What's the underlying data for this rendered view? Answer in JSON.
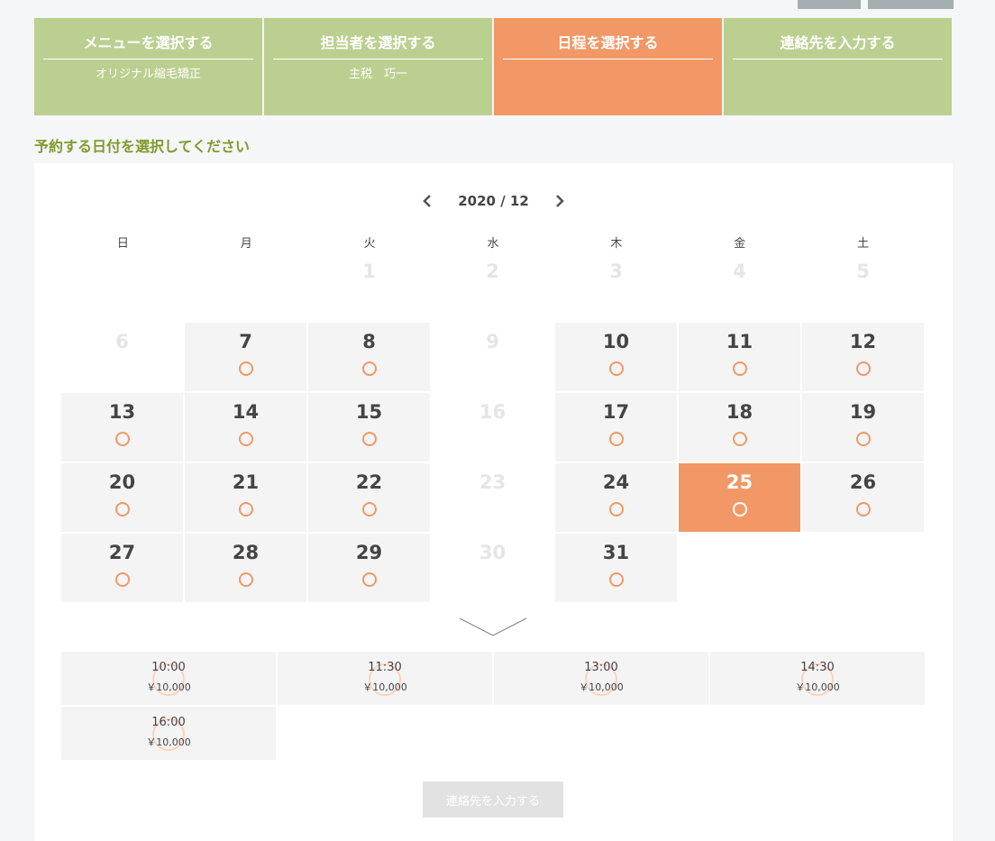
{
  "steps": [
    {
      "title": "メニューを選択する",
      "sub": "オリジナル縮毛矯正"
    },
    {
      "title": "担当者を選択する",
      "sub": "主税　巧一"
    },
    {
      "title": "日程を選択する",
      "sub": ""
    },
    {
      "title": "連絡先を入力する",
      "sub": ""
    }
  ],
  "heading": "予約する日付を選択してください",
  "calendar": {
    "month_label": "2020 / 12",
    "weekdays": [
      "日",
      "月",
      "火",
      "水",
      "木",
      "金",
      "土"
    ],
    "days": [
      {
        "n": "",
        "s": "blank"
      },
      {
        "n": "",
        "s": "blank"
      },
      {
        "n": "1",
        "s": "off"
      },
      {
        "n": "2",
        "s": "off"
      },
      {
        "n": "3",
        "s": "off"
      },
      {
        "n": "4",
        "s": "off"
      },
      {
        "n": "5",
        "s": "off"
      },
      {
        "n": "6",
        "s": "off"
      },
      {
        "n": "7",
        "s": "avail"
      },
      {
        "n": "8",
        "s": "avail"
      },
      {
        "n": "9",
        "s": "off"
      },
      {
        "n": "10",
        "s": "avail"
      },
      {
        "n": "11",
        "s": "avail"
      },
      {
        "n": "12",
        "s": "avail"
      },
      {
        "n": "13",
        "s": "avail"
      },
      {
        "n": "14",
        "s": "avail"
      },
      {
        "n": "15",
        "s": "avail"
      },
      {
        "n": "16",
        "s": "off"
      },
      {
        "n": "17",
        "s": "avail"
      },
      {
        "n": "18",
        "s": "avail"
      },
      {
        "n": "19",
        "s": "avail"
      },
      {
        "n": "20",
        "s": "avail"
      },
      {
        "n": "21",
        "s": "avail"
      },
      {
        "n": "22",
        "s": "avail"
      },
      {
        "n": "23",
        "s": "off"
      },
      {
        "n": "24",
        "s": "avail"
      },
      {
        "n": "25",
        "s": "selected"
      },
      {
        "n": "26",
        "s": "avail"
      },
      {
        "n": "27",
        "s": "avail"
      },
      {
        "n": "28",
        "s": "avail"
      },
      {
        "n": "29",
        "s": "avail"
      },
      {
        "n": "30",
        "s": "off"
      },
      {
        "n": "31",
        "s": "avail"
      },
      {
        "n": "",
        "s": "blank"
      },
      {
        "n": "",
        "s": "blank"
      }
    ]
  },
  "slots": [
    {
      "time": "10:00",
      "price": "￥10,000"
    },
    {
      "time": "11:30",
      "price": "￥10,000"
    },
    {
      "time": "13:00",
      "price": "￥10,000"
    },
    {
      "time": "14:30",
      "price": "￥10,000"
    },
    {
      "time": "16:00",
      "price": "￥10,000"
    }
  ],
  "submit_label": "連絡先を入力する",
  "colors": {
    "green": "#bbd090",
    "orange": "#f29866",
    "heading": "#7e9b2e",
    "disabled": "#e2e2e2"
  },
  "icons": {
    "prev": "chevron-left-icon",
    "next": "chevron-right-icon",
    "expand": "chevron-down-icon",
    "available": "circle-icon"
  }
}
